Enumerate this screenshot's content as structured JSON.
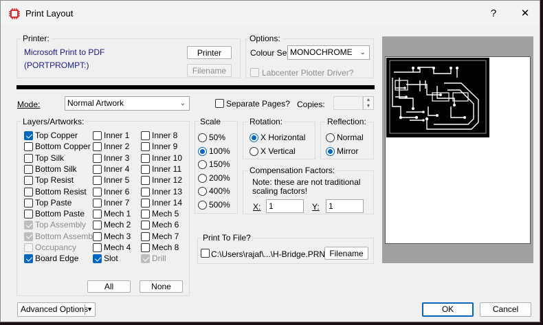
{
  "window": {
    "title": "Print Layout",
    "help_glyph": "?",
    "close_glyph": "✕"
  },
  "printer": {
    "group_label": "Printer:",
    "name": "Microsoft Print to PDF",
    "port": "(PORTPROMPT:)",
    "printer_button": "Printer",
    "filename_button": "Filename"
  },
  "options": {
    "group_label": "Options:",
    "colour_set_label": "Colour Set:",
    "colour_set_value": "MONOCHROME",
    "plotter_driver_label": "Labcenter Plotter Driver?",
    "plotter_driver_checked": false
  },
  "mode": {
    "label": "Mode:",
    "value": "Normal Artwork",
    "separate_pages_label": "Separate Pages?",
    "separate_pages_checked": false,
    "copies_label": "Copies:",
    "copies_value": ""
  },
  "layers": {
    "group_label": "Layers/Artworks:",
    "col1": [
      {
        "label": "Top Copper",
        "checked": true,
        "disabled": false
      },
      {
        "label": "Bottom Copper",
        "checked": false,
        "disabled": false
      },
      {
        "label": "Top Silk",
        "checked": false,
        "disabled": false
      },
      {
        "label": "Bottom Silk",
        "checked": false,
        "disabled": false
      },
      {
        "label": "Top Resist",
        "checked": false,
        "disabled": false
      },
      {
        "label": "Bottom Resist",
        "checked": false,
        "disabled": false
      },
      {
        "label": "Top Paste",
        "checked": false,
        "disabled": false
      },
      {
        "label": "Bottom Paste",
        "checked": false,
        "disabled": false
      },
      {
        "label": "Top Assembly",
        "checked": true,
        "disabled": true
      },
      {
        "label": "Bottom Assembly",
        "checked": true,
        "disabled": true
      },
      {
        "label": "Occupancy",
        "checked": false,
        "disabled": true
      },
      {
        "label": "Board Edge",
        "checked": true,
        "disabled": false
      }
    ],
    "col2": [
      {
        "label": "Inner 1",
        "checked": false,
        "disabled": false
      },
      {
        "label": "Inner 2",
        "checked": false,
        "disabled": false
      },
      {
        "label": "Inner 3",
        "checked": false,
        "disabled": false
      },
      {
        "label": "Inner 4",
        "checked": false,
        "disabled": false
      },
      {
        "label": "Inner 5",
        "checked": false,
        "disabled": false
      },
      {
        "label": "Inner 6",
        "checked": false,
        "disabled": false
      },
      {
        "label": "Inner 7",
        "checked": false,
        "disabled": false
      },
      {
        "label": "Mech 1",
        "checked": false,
        "disabled": false
      },
      {
        "label": "Mech 2",
        "checked": false,
        "disabled": false
      },
      {
        "label": "Mech 3",
        "checked": false,
        "disabled": false
      },
      {
        "label": "Mech 4",
        "checked": false,
        "disabled": false
      },
      {
        "label": "Slot",
        "checked": true,
        "disabled": false
      }
    ],
    "col3": [
      {
        "label": "Inner 8",
        "checked": false,
        "disabled": false
      },
      {
        "label": "Inner 9",
        "checked": false,
        "disabled": false
      },
      {
        "label": "Inner 10",
        "checked": false,
        "disabled": false
      },
      {
        "label": "Inner 11",
        "checked": false,
        "disabled": false
      },
      {
        "label": "Inner 12",
        "checked": false,
        "disabled": false
      },
      {
        "label": "Inner 13",
        "checked": false,
        "disabled": false
      },
      {
        "label": "Inner 14",
        "checked": false,
        "disabled": false
      },
      {
        "label": "Mech 5",
        "checked": false,
        "disabled": false
      },
      {
        "label": "Mech 6",
        "checked": false,
        "disabled": false
      },
      {
        "label": "Mech 7",
        "checked": false,
        "disabled": false
      },
      {
        "label": "Mech 8",
        "checked": false,
        "disabled": false
      },
      {
        "label": "Drill",
        "checked": true,
        "disabled": true
      }
    ],
    "all_button": "All",
    "none_button": "None"
  },
  "scale": {
    "group_label": "Scale",
    "options": [
      {
        "label": "50%",
        "selected": false
      },
      {
        "label": "100%",
        "selected": true
      },
      {
        "label": "150%",
        "selected": false
      },
      {
        "label": "200%",
        "selected": false
      },
      {
        "label": "400%",
        "selected": false
      },
      {
        "label": "500%",
        "selected": false
      }
    ]
  },
  "rotation": {
    "group_label": "Rotation:",
    "options": [
      {
        "label": "X Horizontal",
        "selected": true
      },
      {
        "label": "X Vertical",
        "selected": false
      }
    ]
  },
  "reflection": {
    "group_label": "Reflection:",
    "options": [
      {
        "label": "Normal",
        "selected": false
      },
      {
        "label": "Mirror",
        "selected": true
      }
    ]
  },
  "compensation": {
    "group_label": "Compensation Factors:",
    "note_line1": "Note: these are not traditional",
    "note_line2": "scaling factors!",
    "x_label": "X:",
    "x_value": "1",
    "y_label": "Y:",
    "y_value": "1"
  },
  "print_to_file": {
    "group_label": "Print To File?",
    "checked": false,
    "path": "C:\\Users\\rajaf\\...\\H-Bridge.PRN",
    "filename_button": "Filename"
  },
  "footer": {
    "advanced_options": "Advanced Options",
    "ok_button": "OK",
    "cancel_button": "Cancel"
  },
  "colors": {
    "accent": "#0067c0",
    "preview_bg": "#a0a0a0",
    "pcb_copper": "#000000"
  }
}
